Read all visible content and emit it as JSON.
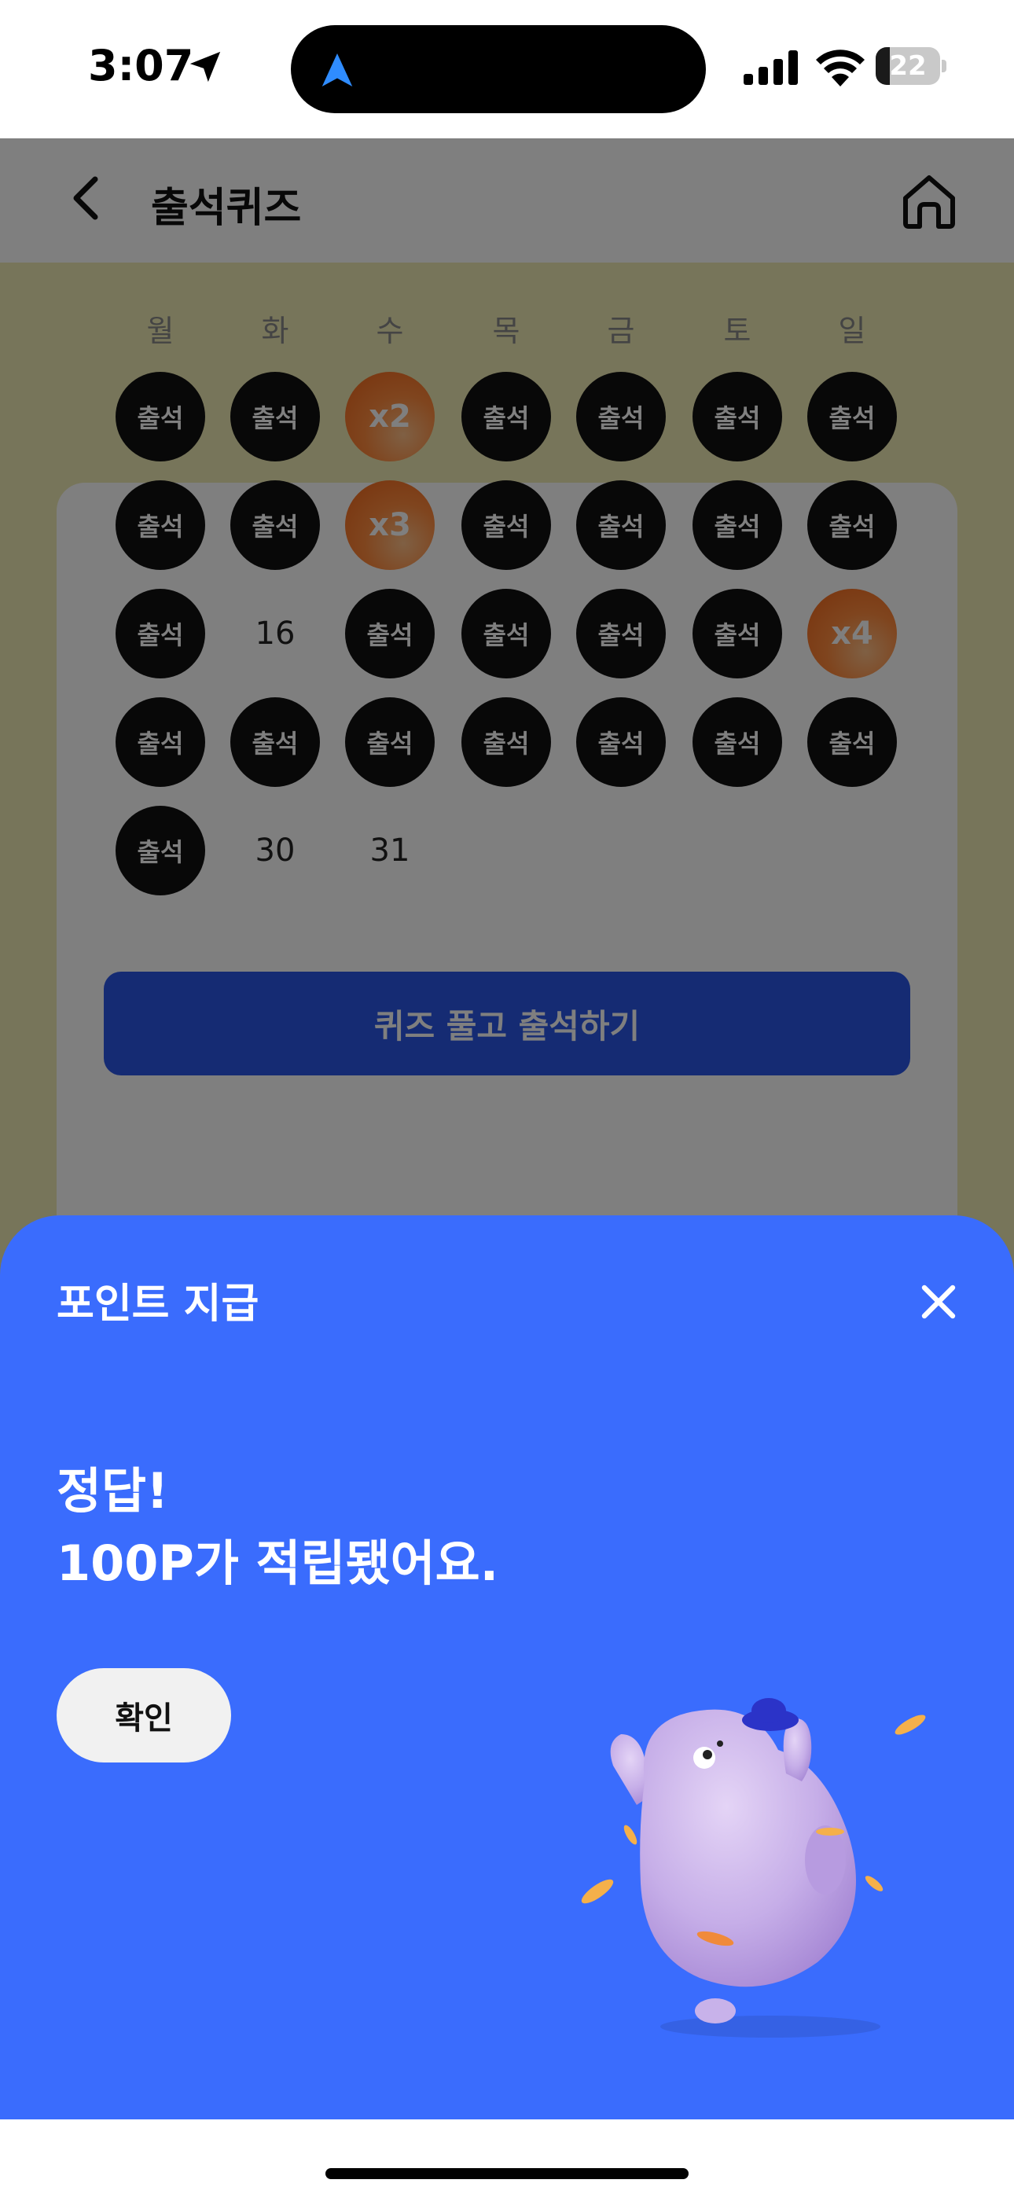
{
  "status_bar": {
    "time": "3:07",
    "battery": "22",
    "battery_level": 0.22
  },
  "app_bar": {
    "title": "출석퀴즈",
    "back_icon": "chevron-left-icon",
    "home_icon": "home-icon"
  },
  "calendar": {
    "weekdays": [
      "월",
      "화",
      "수",
      "목",
      "금",
      "토",
      "일"
    ],
    "rows": [
      [
        {
          "type": "att",
          "text": "출석"
        },
        {
          "type": "att",
          "text": "출석"
        },
        {
          "type": "bonus",
          "text": "x2"
        },
        {
          "type": "att",
          "text": "출석"
        },
        {
          "type": "att",
          "text": "출석"
        },
        {
          "type": "att",
          "text": "출석"
        },
        {
          "type": "att",
          "text": "출석"
        }
      ],
      [
        {
          "type": "att",
          "text": "출석"
        },
        {
          "type": "att",
          "text": "출석"
        },
        {
          "type": "bonus",
          "text": "x3"
        },
        {
          "type": "att",
          "text": "출석"
        },
        {
          "type": "att",
          "text": "출석"
        },
        {
          "type": "att",
          "text": "출석"
        },
        {
          "type": "att",
          "text": "출석"
        }
      ],
      [
        {
          "type": "att",
          "text": "출석"
        },
        {
          "type": "num",
          "text": "16"
        },
        {
          "type": "att",
          "text": "출석"
        },
        {
          "type": "att",
          "text": "출석"
        },
        {
          "type": "att",
          "text": "출석"
        },
        {
          "type": "att",
          "text": "출석"
        },
        {
          "type": "bonus",
          "text": "x4"
        }
      ],
      [
        {
          "type": "att",
          "text": "출석"
        },
        {
          "type": "att",
          "text": "출석"
        },
        {
          "type": "att",
          "text": "출석"
        },
        {
          "type": "att",
          "text": "출석"
        },
        {
          "type": "att",
          "text": "출석"
        },
        {
          "type": "att",
          "text": "출석"
        },
        {
          "type": "att",
          "text": "출석"
        }
      ],
      [
        {
          "type": "att",
          "text": "출석"
        },
        {
          "type": "num",
          "text": "30"
        },
        {
          "type": "num",
          "text": "31"
        }
      ]
    ]
  },
  "quiz_button": "퀴즈 풀고 출석하기",
  "sheet": {
    "title": "포인트 지급",
    "line1": "정답!",
    "line2": "100P가 적립됐어요.",
    "confirm": "확인"
  },
  "colors": {
    "accent": "#3a6cfd",
    "attended": "#111111",
    "bonus": "#f06418"
  }
}
